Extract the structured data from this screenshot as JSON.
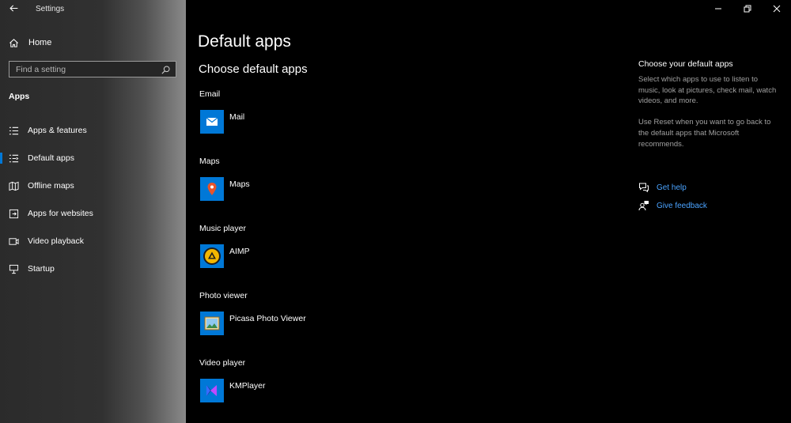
{
  "window": {
    "title": "Settings",
    "controls": {
      "minimize_icon": "minimize-icon",
      "restore_icon": "restore-icon",
      "close_icon": "close-icon"
    }
  },
  "sidebar": {
    "home_label": "Home",
    "search_placeholder": "Find a setting",
    "section_title": "Apps",
    "items": [
      {
        "label": "Apps & features",
        "icon": "list-icon",
        "selected": false
      },
      {
        "label": "Default apps",
        "icon": "default-apps-icon",
        "selected": true
      },
      {
        "label": "Offline maps",
        "icon": "map-icon",
        "selected": false
      },
      {
        "label": "Apps for websites",
        "icon": "web-apps-icon",
        "selected": false
      },
      {
        "label": "Video playback",
        "icon": "video-icon",
        "selected": false
      },
      {
        "label": "Startup",
        "icon": "startup-icon",
        "selected": false
      }
    ]
  },
  "main": {
    "title": "Default apps",
    "subtitle": "Choose default apps",
    "categories": [
      {
        "label": "Email",
        "app": "Mail",
        "icon": "mail-icon"
      },
      {
        "label": "Maps",
        "app": "Maps",
        "icon": "maps-pin-icon"
      },
      {
        "label": "Music player",
        "app": "AIMP",
        "icon": "aimp-icon"
      },
      {
        "label": "Photo viewer",
        "app": "Picasa Photo Viewer",
        "icon": "picture-icon"
      },
      {
        "label": "Video player",
        "app": "KMPlayer",
        "icon": "kmplayer-icon"
      }
    ]
  },
  "info_panel": {
    "title": "Choose your default apps",
    "text1": "Select which apps to use to listen to music, look at pictures, check mail, watch videos, and more.",
    "text2": "Use Reset when you want to go back to the default apps that Microsoft recommends.",
    "links": [
      {
        "label": "Get help",
        "icon": "help-chat-icon"
      },
      {
        "label": "Give feedback",
        "icon": "feedback-icon"
      }
    ]
  },
  "colors": {
    "accent": "#0078d7",
    "link": "#4aa3ff",
    "app_tile": "#0078d7"
  }
}
